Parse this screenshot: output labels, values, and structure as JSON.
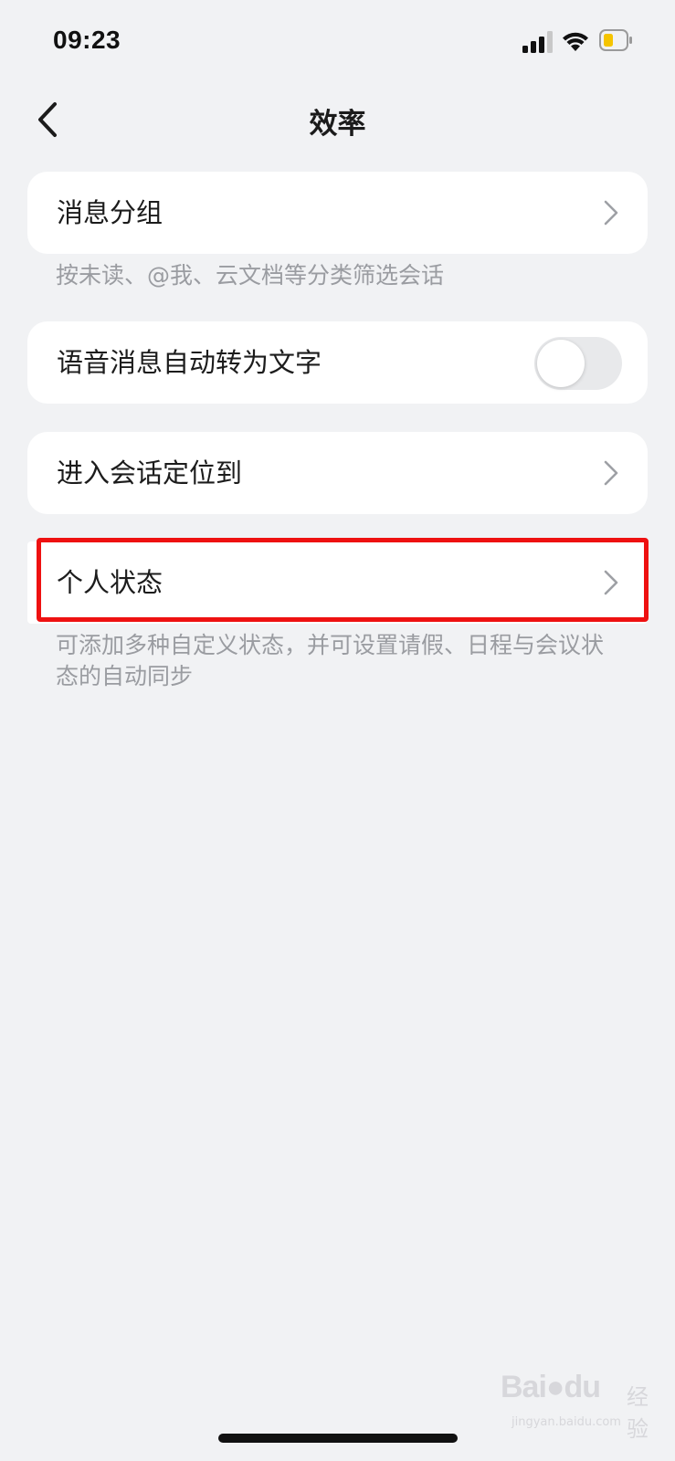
{
  "status_bar": {
    "time": "09:23",
    "icons": [
      "cellular-signal-icon",
      "wifi-icon",
      "battery-icon"
    ],
    "battery_color": "#f5c400"
  },
  "nav": {
    "title": "效率",
    "back_icon": "chevron-left-icon"
  },
  "settings": {
    "message_groups": {
      "label": "消息分组",
      "hint": "按未读、@我、云文档等分类筛选会话"
    },
    "voice_to_text": {
      "label": "语音消息自动转为文字",
      "enabled": false
    },
    "enter_chat_locate": {
      "label": "进入会话定位到"
    },
    "personal_status": {
      "label": "个人状态",
      "hint": "可添加多种自定义状态，并可设置请假、日程与会议状态的自动同步",
      "highlighted": true,
      "highlight_color": "#ee1111"
    }
  },
  "watermark": {
    "brand": "Bai",
    "brand_suffix": "du",
    "product": "经验",
    "url": "jingyan.baidu.com"
  },
  "colors": {
    "background": "#f1f2f4",
    "card": "#ffffff",
    "hint_text": "#9a9ca1"
  }
}
